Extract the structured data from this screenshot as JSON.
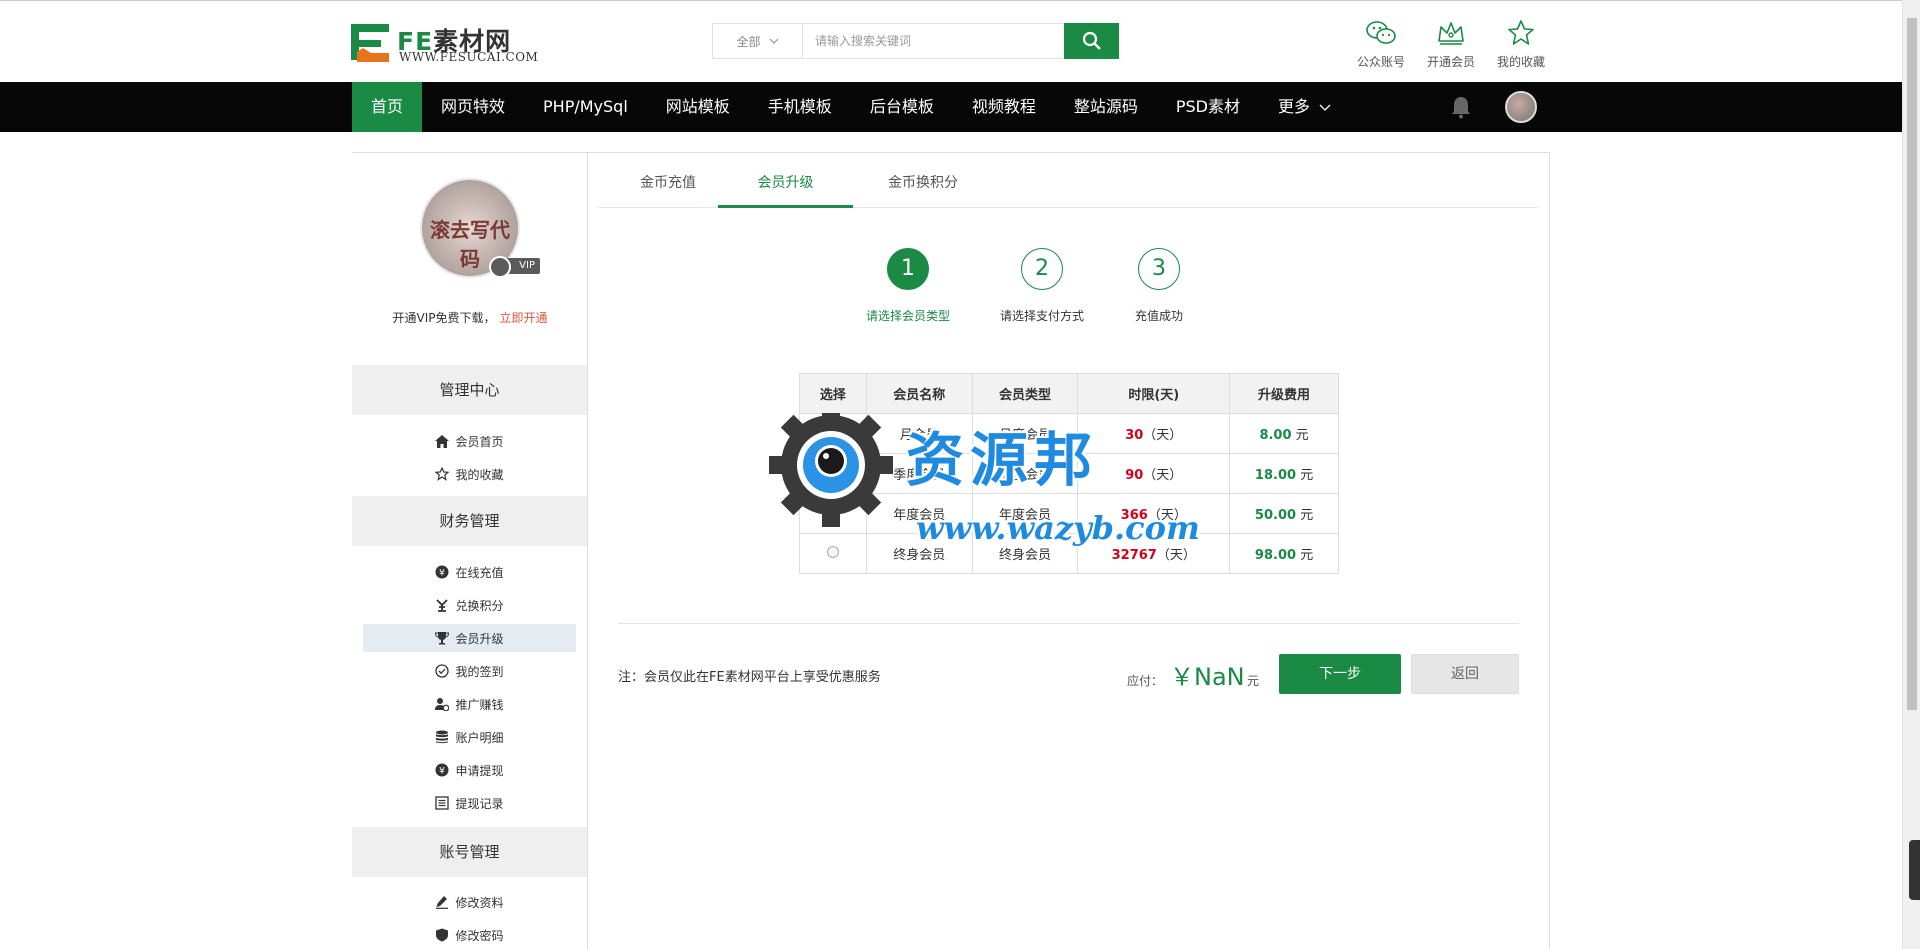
{
  "header": {
    "logo_title_fe": "FE",
    "logo_title_rest": "素材网",
    "logo_sub": "WWW.FESUCAI.COM",
    "search": {
      "category": "全部",
      "placeholder": "请输入搜索关键词",
      "value": ""
    },
    "quick_links": [
      {
        "label": "公众账号",
        "icon": "wechat-icon"
      },
      {
        "label": "开通会员",
        "icon": "crown-icon"
      },
      {
        "label": "我的收藏",
        "icon": "star-icon"
      }
    ]
  },
  "nav": {
    "items": [
      "首页",
      "网页特效",
      "PHP/MySql",
      "网站模板",
      "手机模板",
      "后台模板",
      "视频教程",
      "整站源码",
      "PSD素材",
      "更多"
    ],
    "active_index": 0
  },
  "sidebar": {
    "avatar_text": "滚去写代码",
    "vip_badge": "VIP",
    "vip_note": "开通VIP免费下载，",
    "vip_open": "立即开通",
    "groups": [
      {
        "title": "管理中心",
        "items": [
          {
            "label": "会员首页",
            "icon": "home-icon"
          },
          {
            "label": "我的收藏",
            "icon": "star-outline-icon"
          }
        ]
      },
      {
        "title": "财务管理",
        "items": [
          {
            "label": "在线充值",
            "icon": "yen-coin-icon"
          },
          {
            "label": "兑换积分",
            "icon": "exchange-icon"
          },
          {
            "label": "会员升级",
            "icon": "trophy-icon",
            "active": true
          },
          {
            "label": "我的签到",
            "icon": "check-circle-icon"
          },
          {
            "label": "推广赚钱",
            "icon": "user-money-icon"
          },
          {
            "label": "账户明细",
            "icon": "database-icon"
          },
          {
            "label": "申请提现",
            "icon": "yen-coin-icon"
          },
          {
            "label": "提现记录",
            "icon": "list-icon"
          }
        ]
      },
      {
        "title": "账号管理",
        "items": [
          {
            "label": "修改资料",
            "icon": "edit-icon"
          },
          {
            "label": "修改密码",
            "icon": "shield-icon"
          }
        ]
      }
    ]
  },
  "tabs": [
    {
      "label": "金币充值"
    },
    {
      "label": "会员升级",
      "active": true
    },
    {
      "label": "金币换积分"
    }
  ],
  "steps": [
    {
      "num": "1",
      "label": "请选择会员类型",
      "active": true
    },
    {
      "num": "2",
      "label": "请选择支付方式"
    },
    {
      "num": "3",
      "label": "充值成功"
    }
  ],
  "table": {
    "headers": [
      "选择",
      "会员名称",
      "会员类型",
      "时限(天)",
      "升级费用"
    ],
    "rows": [
      {
        "name": "月会员",
        "type": "月度会员",
        "days": "30",
        "days_unit": "（天）",
        "price": "8.00",
        "price_unit": "元"
      },
      {
        "name": "季度会员",
        "type": "季度会员",
        "days": "90",
        "days_unit": "（天）",
        "price": "18.00",
        "price_unit": "元"
      },
      {
        "name": "年度会员",
        "type": "年度会员",
        "days": "366",
        "days_unit": "（天）",
        "price": "50.00",
        "price_unit": "元"
      },
      {
        "name": "终身会员",
        "type": "终身会员",
        "days": "32767",
        "days_unit": "（天）",
        "price": "98.00",
        "price_unit": "元"
      }
    ]
  },
  "footer": {
    "note": "注：会员仅此在FE素材网平台上享受优惠服务",
    "pay_label": "应付：",
    "pay_amount": "￥NaN",
    "pay_unit": "元",
    "next_label": "下一步",
    "back_label": "返回"
  },
  "watermark": {
    "text1": "资源邦",
    "text2": "www.wazyb.com"
  },
  "colors": {
    "brand_green": "#1a8a45",
    "nav_bg": "#070707",
    "days_red": "#d0021b",
    "watermark_blue": "#1f8be0"
  }
}
